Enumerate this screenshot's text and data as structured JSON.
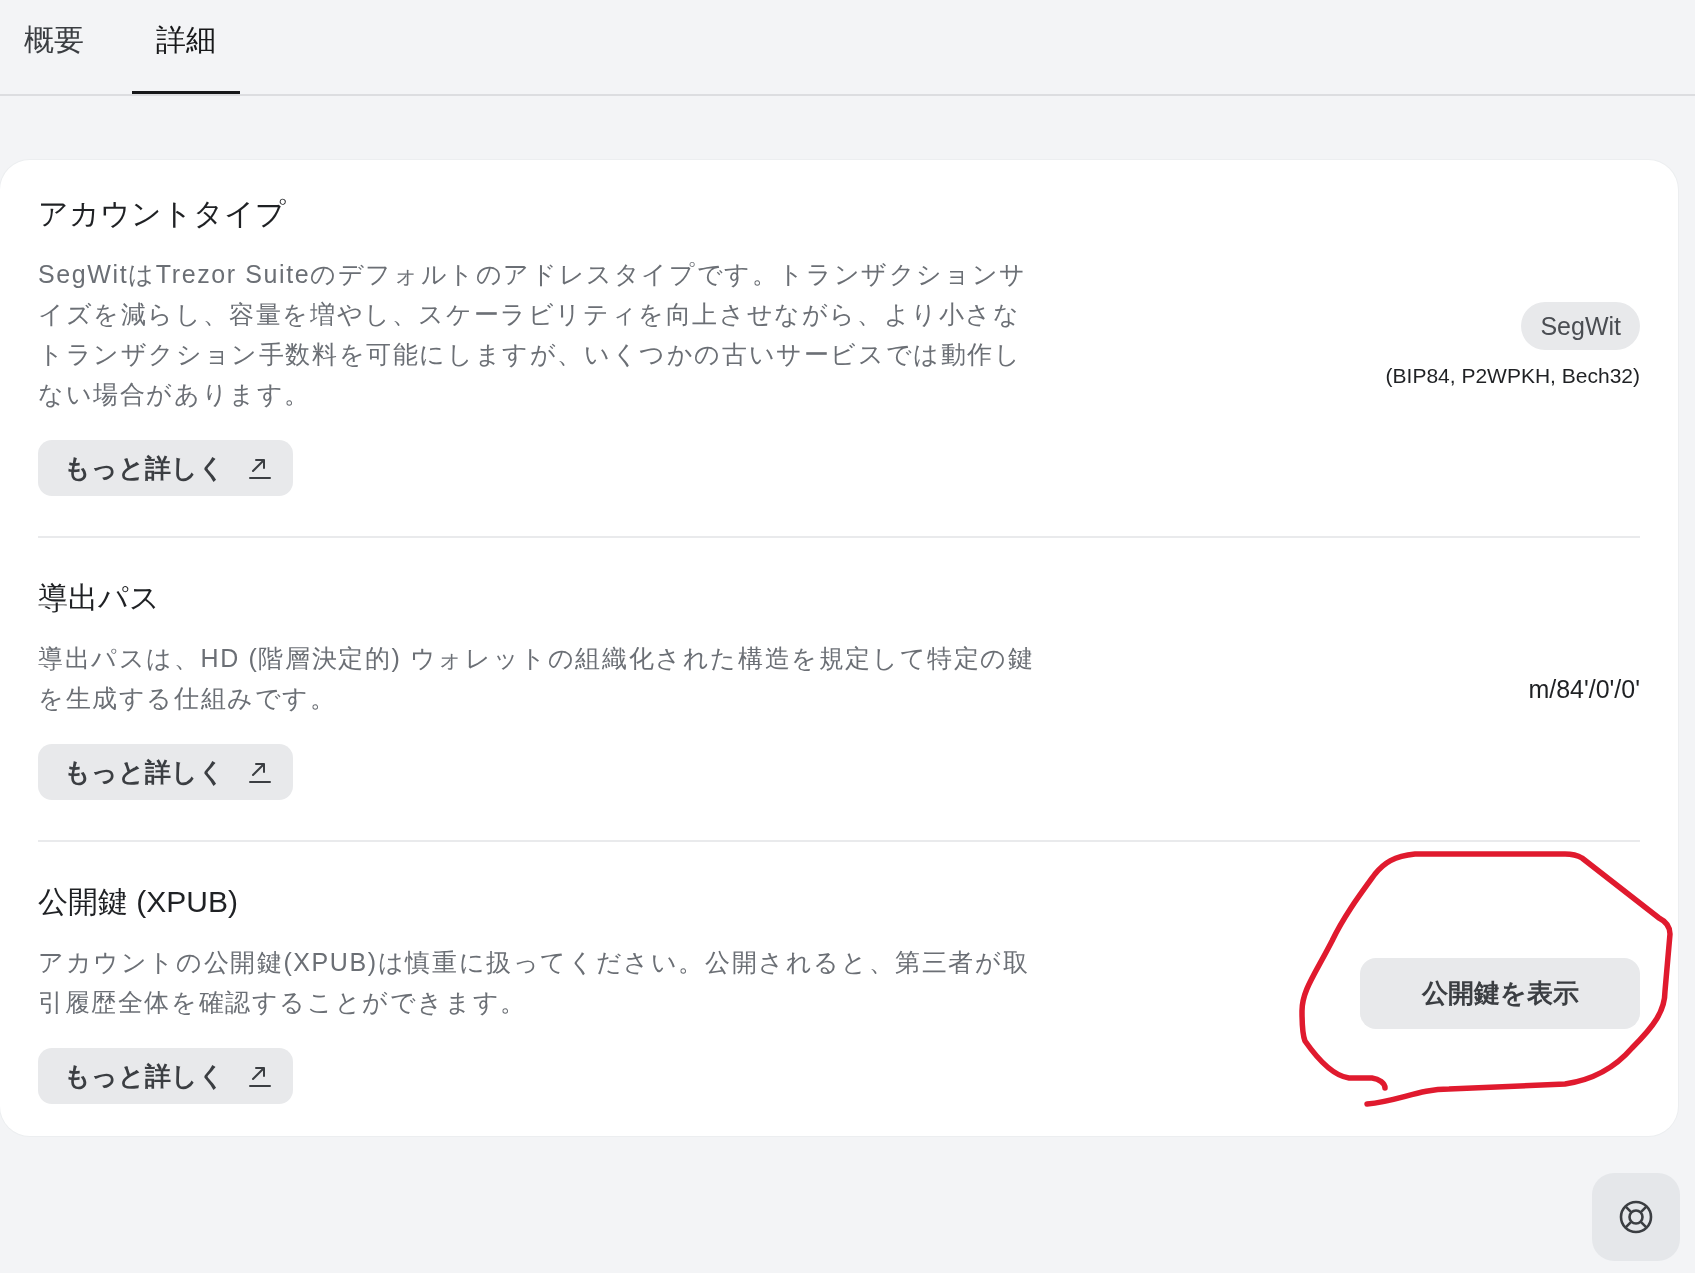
{
  "tabs": [
    {
      "label": "概要",
      "selected": false
    },
    {
      "label": "詳細",
      "selected": true
    }
  ],
  "sections": [
    {
      "kind": "badge",
      "title": "アカウントタイプ",
      "description": "SegWitはTrezor Suiteのデフォルトのアドレスタイプです。トランザクションサイズを減らし、容量を増やし、スケーラビリティを向上させながら、より小さなトランザクション手数料を可能にしますが、いくつかの古いサービスでは動作しない場合があります。",
      "link": "もっと詳しく",
      "badge": "SegWit",
      "value": "(BIP84, P2WPKH, Bech32)"
    },
    {
      "kind": "value",
      "title": "導出パス",
      "description": "導出パスは、HD (階層決定的) ウォレットの組織化された構造を規定して特定の鍵を生成する仕組みです。",
      "link": "もっと詳しく",
      "value": "m/84'/0'/0'"
    },
    {
      "kind": "button",
      "title": "公開鍵 (XPUB)",
      "description": "アカウントの公開鍵(XPUB)は慎重に扱ってください。公開されると、第三者が取引履歴全体を確認することができます。",
      "link": "もっと詳しく",
      "button": "公開鍵を表示",
      "circled": true
    }
  ]
}
